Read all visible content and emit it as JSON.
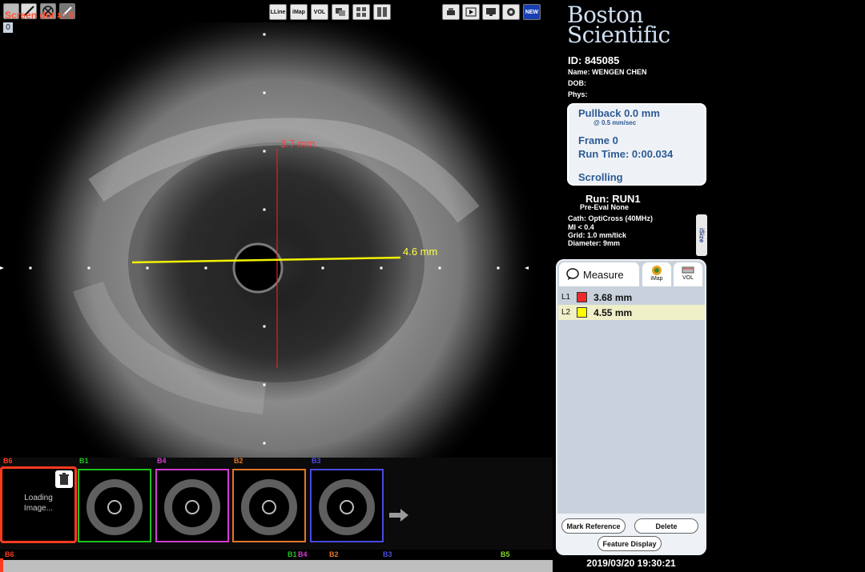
{
  "toolbar": {
    "screen_label": "Screen dot #: 6",
    "frame_index": "0",
    "buttons_left": [
      "pen-tool",
      "erase",
      "scissors"
    ],
    "buttons_center": [
      {
        "name": "lline-button",
        "label": "LLine"
      },
      {
        "name": "imap-button",
        "label": "iMap"
      },
      {
        "name": "vol-button",
        "label": "VOL"
      },
      {
        "name": "overlay-button",
        "label": ""
      },
      {
        "name": "grid-view-button",
        "label": ""
      },
      {
        "name": "split-view-button",
        "label": ""
      }
    ],
    "buttons_right": [
      {
        "name": "print-button",
        "label": ""
      },
      {
        "name": "play-button",
        "label": ""
      },
      {
        "name": "monitor-button",
        "label": ""
      },
      {
        "name": "record-button",
        "label": ""
      },
      {
        "name": "new-button",
        "label": "NEW"
      }
    ]
  },
  "brand": {
    "line1": "Boston",
    "line2": "Scientific"
  },
  "patient": {
    "id": "ID: 845085",
    "name_label": "Name:",
    "name": "WENGEN CHEN",
    "dob_label": "DOB:",
    "dob": "",
    "phys_label": "Phys:",
    "phys": ""
  },
  "pullback": {
    "title": "Pullback 0.0 mm",
    "speed": "@ 0.5 mm/sec",
    "frame": "Frame 0",
    "runtime": "Run Time: 0:00.034",
    "mode": "Scrolling"
  },
  "run": {
    "name": "Run: RUN1",
    "preeval": "Pre-Eval None",
    "cath": "Cath: OptiCross (40MHz)",
    "mi": "MI <  0.4",
    "grid": "Grid:   1.0 mm/tick",
    "diameter": "Diameter:   9mm"
  },
  "istize": "iSize",
  "image": {
    "vertical_measure_label": "3.7 mm",
    "horizontal_measure_label": "4.6 mm",
    "vertical_color": "#e02020",
    "horizontal_color": "#f2f200"
  },
  "measure": {
    "tab_label": "Measure",
    "tab2_label": "iMap",
    "tab3_label": "VOL",
    "items": [
      {
        "id": "L1",
        "value": "3.68 mm",
        "color": "#ee2a2a"
      },
      {
        "id": "L2",
        "value": "4.55 mm",
        "color": "#ffff00"
      }
    ],
    "mark_reference": "Mark Reference",
    "delete": "Delete",
    "feature_display": "Feature Display"
  },
  "datetime": "2019/03/20 19:30:21",
  "bookmarks": [
    {
      "id": "B6",
      "color": "#ff3b1f",
      "loading": "Loading\nImage..."
    },
    {
      "id": "B1",
      "color": "#1fc21f"
    },
    {
      "id": "B4",
      "color": "#d23cd2"
    },
    {
      "id": "B2",
      "color": "#e3772a"
    },
    {
      "id": "B3",
      "color": "#4a4ae0"
    }
  ],
  "timeline_labels": [
    {
      "id": "B6",
      "color": "#ff3b1f"
    },
    {
      "id": "B1",
      "color": "#1fc21f"
    },
    {
      "id": "B4",
      "color": "#d23cd2"
    },
    {
      "id": "B2",
      "color": "#e3772a"
    },
    {
      "id": "B3",
      "color": "#4a4ae0"
    },
    {
      "id": "B5",
      "color": "#8ad62a"
    }
  ]
}
